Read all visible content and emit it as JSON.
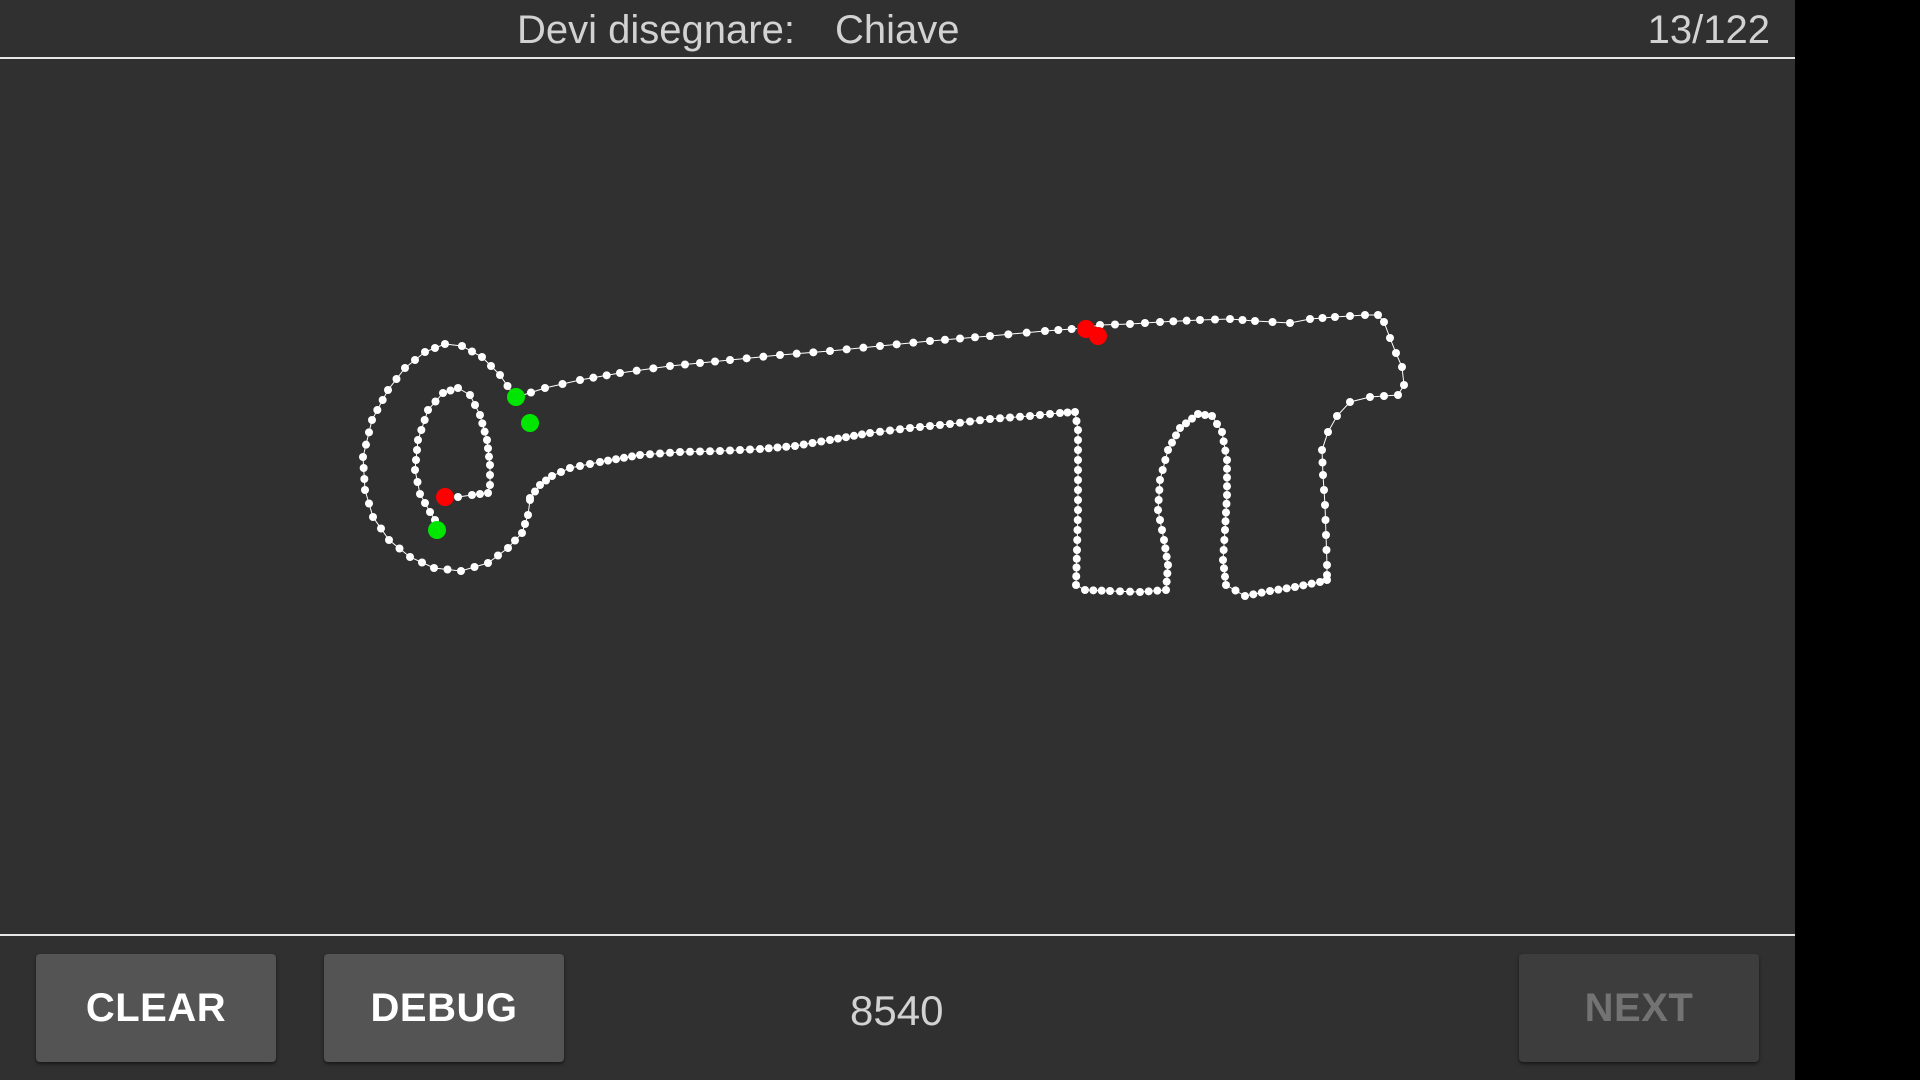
{
  "header": {
    "prompt_label": "Devi disegnare:",
    "prompt_word": "Chiave",
    "progress": "13/122"
  },
  "toolbar": {
    "clear_label": "CLEAR",
    "debug_label": "DEBUG",
    "score": "8540",
    "next_label": "NEXT"
  },
  "colors": {
    "background": "#303030",
    "stroke_point": "#ffffff",
    "stroke_start": "#00e600",
    "stroke_end": "#ff0000",
    "button": "#545454",
    "button_disabled": "#3d3d3d"
  }
}
